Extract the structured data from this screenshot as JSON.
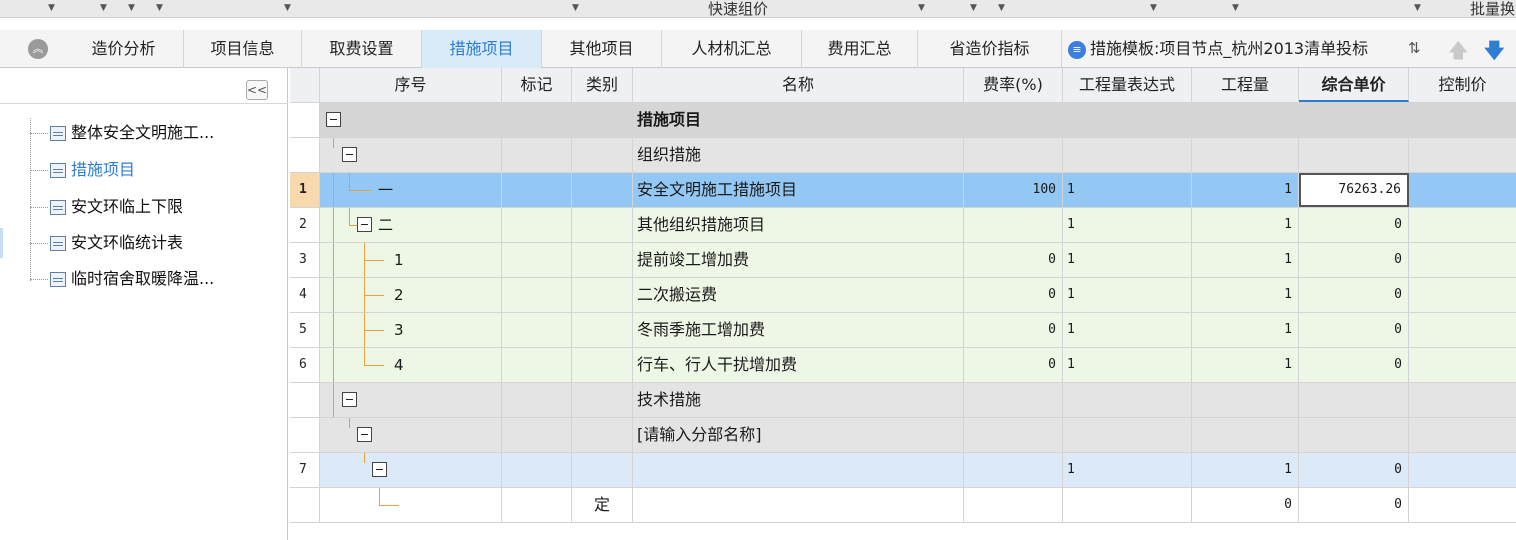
{
  "toolbar": {
    "quick_price": "快速组价",
    "batch": "批量换"
  },
  "tabs": [
    {
      "label": "造价分析"
    },
    {
      "label": "项目信息"
    },
    {
      "label": "取费设置"
    },
    {
      "label": "措施项目"
    },
    {
      "label": "其他项目"
    },
    {
      "label": "人材机汇总"
    },
    {
      "label": "费用汇总"
    },
    {
      "label": "省造价指标"
    }
  ],
  "template": {
    "label": "措施模板:项目节点_杭州2013清单投标"
  },
  "tree": {
    "collapse_label": "<<",
    "items": [
      {
        "label": "整体安全文明施工..."
      },
      {
        "label": "措施项目"
      },
      {
        "label": "安文环临上下限"
      },
      {
        "label": "安文环临统计表"
      },
      {
        "label": "临时宿舍取暖降温..."
      }
    ]
  },
  "grid": {
    "headers": [
      "序号",
      "标记",
      "类别",
      "名称",
      "费率(%)",
      "工程量表达式",
      "工程量",
      "综合单价",
      "控制价"
    ],
    "rows": [
      {
        "idx": "",
        "seq": "",
        "mark": "",
        "category": "",
        "name": "措施项目",
        "rate": "",
        "expr": "",
        "qty": "",
        "unit_price": "",
        "control": ""
      },
      {
        "idx": "",
        "seq": "",
        "mark": "",
        "category": "",
        "name": "组织措施",
        "rate": "",
        "expr": "",
        "qty": "",
        "unit_price": "",
        "control": ""
      },
      {
        "idx": "1",
        "seq": "一",
        "mark": "",
        "category": "",
        "name": "安全文明施工措施项目",
        "rate": "100",
        "expr": "1",
        "qty": "1",
        "unit_price": "76263.26",
        "control": ""
      },
      {
        "idx": "2",
        "seq": "二",
        "mark": "",
        "category": "",
        "name": "其他组织措施项目",
        "rate": "",
        "expr": "1",
        "qty": "1",
        "unit_price": "0",
        "control": ""
      },
      {
        "idx": "3",
        "seq": "1",
        "mark": "",
        "category": "",
        "name": "提前竣工增加费",
        "rate": "0",
        "expr": "1",
        "qty": "1",
        "unit_price": "0",
        "control": ""
      },
      {
        "idx": "4",
        "seq": "2",
        "mark": "",
        "category": "",
        "name": "二次搬运费",
        "rate": "0",
        "expr": "1",
        "qty": "1",
        "unit_price": "0",
        "control": ""
      },
      {
        "idx": "5",
        "seq": "3",
        "mark": "",
        "category": "",
        "name": "冬雨季施工增加费",
        "rate": "0",
        "expr": "1",
        "qty": "1",
        "unit_price": "0",
        "control": ""
      },
      {
        "idx": "6",
        "seq": "4",
        "mark": "",
        "category": "",
        "name": "行车、行人干扰增加费",
        "rate": "0",
        "expr": "1",
        "qty": "1",
        "unit_price": "0",
        "control": ""
      },
      {
        "idx": "",
        "seq": "",
        "mark": "",
        "category": "",
        "name": "技术措施",
        "rate": "",
        "expr": "",
        "qty": "",
        "unit_price": "",
        "control": ""
      },
      {
        "idx": "",
        "seq": "",
        "mark": "",
        "category": "",
        "name": "[请输入分部名称]",
        "rate": "",
        "expr": "",
        "qty": "",
        "unit_price": "",
        "control": ""
      },
      {
        "idx": "7",
        "seq": "",
        "mark": "",
        "category": "",
        "name": "",
        "rate": "",
        "expr": "1",
        "qty": "1",
        "unit_price": "0",
        "control": ""
      },
      {
        "idx": "",
        "seq": "",
        "mark": "",
        "category": "定",
        "name": "",
        "rate": "",
        "expr": "",
        "qty": "0",
        "unit_price": "0",
        "control": ""
      }
    ]
  },
  "colors": {
    "accent": "#2f7dd1",
    "selected_row": "#93c8f4",
    "item_row": "#eef6e6",
    "group_row": "#e4e4e4"
  }
}
